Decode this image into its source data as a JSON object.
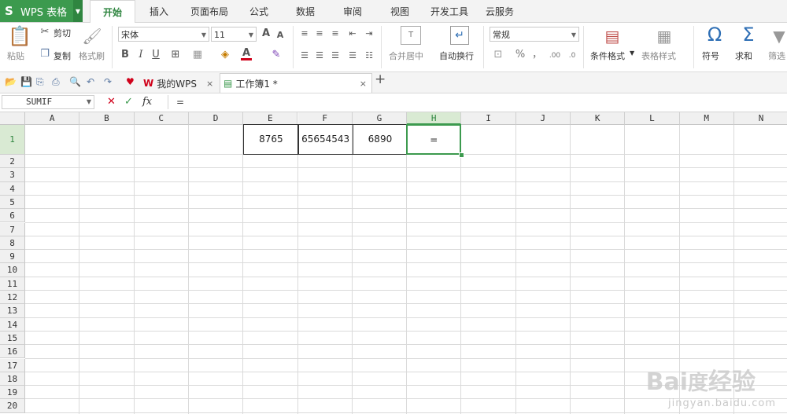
{
  "app": {
    "logo": "S",
    "title": "WPS 表格",
    "dropdown": "▼"
  },
  "menu_tabs": [
    "开始",
    "插入",
    "页面布局",
    "公式",
    "数据",
    "审阅",
    "视图",
    "开发工具",
    "云服务"
  ],
  "ribbon": {
    "paste": "粘贴",
    "cut": "剪切",
    "copy": "复制",
    "format_painter": "格式刷",
    "font_name": "宋体",
    "font_size": "11",
    "merge_center": "合并居中",
    "wrap_text": "自动换行",
    "number_format": "常规",
    "percent": "%",
    "comma": "，",
    "conditional_format": "条件格式",
    "table_style": "表格样式",
    "symbol": "符号",
    "sum": "求和",
    "filter": "筛选",
    "symbol_glyph": "Ω",
    "sum_glyph": "Σ",
    "bold": "B",
    "italic": "I",
    "underline": "U",
    "grow_font": "A",
    "shrink_font": "A",
    "font_color": "A",
    "dec_inc": ".00",
    "dec_dec": ".0"
  },
  "doc_tabs": [
    {
      "label": "我的WPS",
      "close": "×"
    },
    {
      "label": "工作簿1 *",
      "close": "×"
    }
  ],
  "new_tab": "+",
  "formula_bar": {
    "name_box": "SUMIF",
    "cancel": "✕",
    "enter": "✓",
    "fx": "fx",
    "formula": "="
  },
  "columns": [
    "A",
    "B",
    "C",
    "D",
    "E",
    "F",
    "G",
    "H",
    "I",
    "J",
    "K",
    "L",
    "M",
    "N"
  ],
  "rows": [
    "1",
    "2",
    "3",
    "4",
    "5",
    "6",
    "7",
    "8",
    "9",
    "10",
    "11",
    "12",
    "13",
    "14",
    "15",
    "16",
    "17",
    "18",
    "19",
    "20"
  ],
  "cells": {
    "E1": "8765",
    "F1": "65654543",
    "G1": "6890",
    "H1": "="
  },
  "active_cell": "H1",
  "watermark": {
    "main": "Bai度经验",
    "sub": "jingyan.baidu.com"
  },
  "colors": {
    "accent": "#3c9a4e",
    "selected_header": "#d9ead3"
  }
}
